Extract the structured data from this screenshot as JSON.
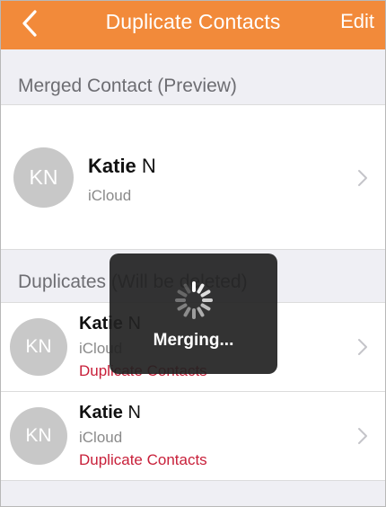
{
  "nav": {
    "title": "Duplicate Contacts",
    "edit_label": "Edit"
  },
  "merged": {
    "header": "Merged Contact (Preview)",
    "contact": {
      "initials": "KN",
      "first": "Katie",
      "last": "N",
      "source": "iCloud"
    }
  },
  "duplicates": {
    "header": "Duplicates (Will be deleted)",
    "items": [
      {
        "initials": "KN",
        "first": "Katie",
        "last": "N",
        "source": "iCloud",
        "group": "Duplicate Contacts"
      },
      {
        "initials": "KN",
        "first": "Katie",
        "last": "N",
        "source": "iCloud",
        "group": "Duplicate Contacts"
      }
    ]
  },
  "hud": {
    "label": "Merging..."
  },
  "colors": {
    "accent": "#f28a3a",
    "danger": "#c8203a",
    "avatar": "#c8c8c8"
  },
  "icons": {
    "back": "chevron-left-icon",
    "disclosure": "chevron-right-icon",
    "spinner": "spinner-icon"
  }
}
